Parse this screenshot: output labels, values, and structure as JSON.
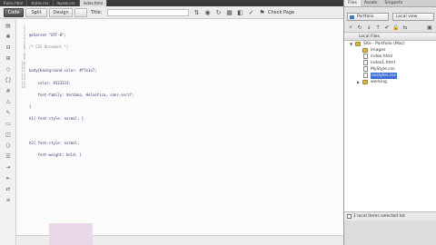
{
  "doc_tabs": [
    "Rules.html",
    "styles.css",
    "layout.css",
    "index.html"
  ],
  "toolbar": {
    "code_label": "Code",
    "split_label": "Split",
    "design_label": "Design",
    "title_label": "Title:",
    "check_page_label": "Check Page"
  },
  "editor": {
    "line_numbers": [
      "1",
      "2",
      "3",
      "4",
      "5",
      "6",
      "7",
      "8",
      "9",
      "10",
      "11",
      "12",
      "13",
      "14",
      "15",
      "16"
    ],
    "code_lines": [
      "@charset \"UTF-8\";",
      "/* CSS Document */",
      "",
      "body{background-color: #f7e1e7;",
      "    color: #333333;",
      "    font-family: Verdana, Helvetica, sans-serif;",
      "}",
      "h1{ font-style: normal; }",
      "",
      "h2{ font-style: normal;",
      "    font-weight: bold; }",
      "",
      "",
      "",
      "",
      ""
    ]
  },
  "panel": {
    "tabs": [
      "Files",
      "Assets",
      "Snippets"
    ],
    "site_select": "Portfolio",
    "view_select": "Local view",
    "tree_header": "Local Files",
    "tree": [
      {
        "label": "Site - Portfolio (Mac)",
        "kind": "folder",
        "depth": 0,
        "expanded": true
      },
      {
        "label": "images",
        "kind": "folder",
        "depth": 1
      },
      {
        "label": "index.html",
        "kind": "file",
        "depth": 1
      },
      {
        "label": "index1.html",
        "kind": "file",
        "depth": 1
      },
      {
        "label": "MyStyle.css",
        "kind": "file",
        "depth": 1
      },
      {
        "label": "osstyles.css",
        "kind": "file",
        "depth": 1,
        "selected": true
      },
      {
        "label": "working",
        "kind": "folder",
        "depth": 1,
        "collapsed": true
      }
    ],
    "status": "1 local items selected tot"
  }
}
